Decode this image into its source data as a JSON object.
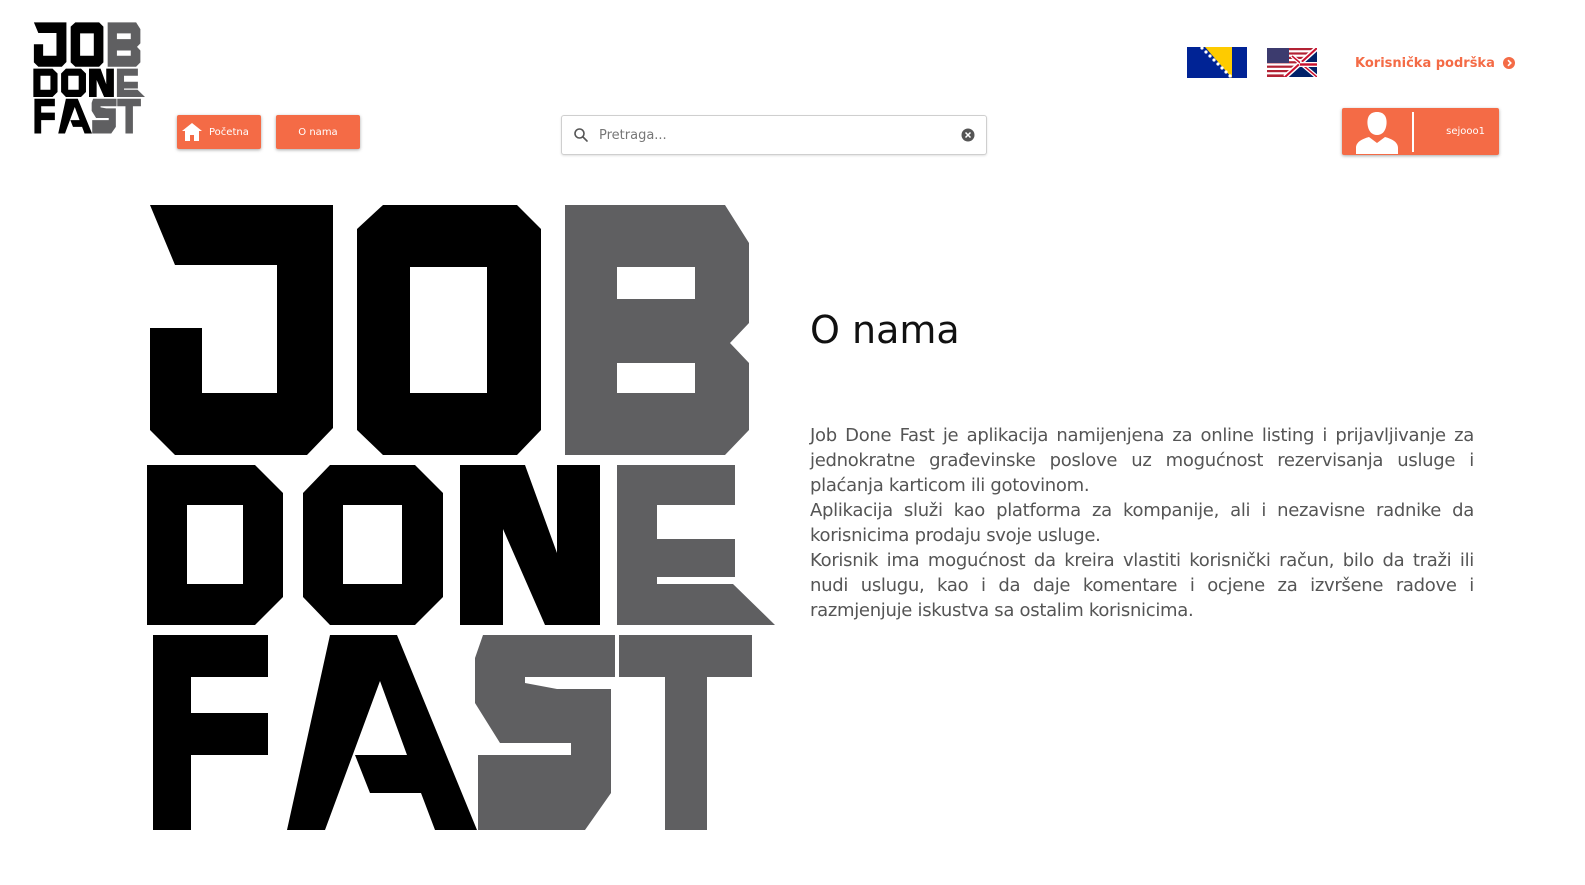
{
  "logo": {
    "line1": "JOB",
    "line2": "DONE",
    "line3": "FAST"
  },
  "nav": {
    "home_label": "Početna",
    "about_label": "O nama"
  },
  "search": {
    "placeholder": "Pretraga..."
  },
  "header": {
    "support_label": "Korisnička podrška",
    "username": "sejooo1"
  },
  "colors": {
    "accent": "#f46b46",
    "logo_black": "#000000",
    "logo_gray": "#5f5f61"
  },
  "about": {
    "title": "O nama",
    "paragraphs": [
      "Job Done Fast je aplikacija namijenjena za online listing i prijavljivanje za jednokratne  građevinske poslove uz mogućnost rezervisanja usluge i plaćanja karticom ili gotovinom.",
      "Aplikacija služi kao platforma za kompanije, ali i nezavisne radnike da korisnicima prodaju svoje usluge.",
      "Korisnik ima mogućnost da kreira vlastiti korisnički račun, bilo da traži ili nudi uslugu, kao i da daje komentare i ocjene za izvršene radove i razmjenjuje iskustva sa ostalim korisnicima."
    ]
  },
  "icons": {
    "home": "home-icon",
    "search": "search-icon",
    "clear": "clear-icon",
    "support_arrow": "chevron-right-circle-icon",
    "user": "user-silhouette-icon",
    "flag_ba": "bosnia-flag-icon",
    "flag_uk": "uk-us-flag-icon"
  }
}
